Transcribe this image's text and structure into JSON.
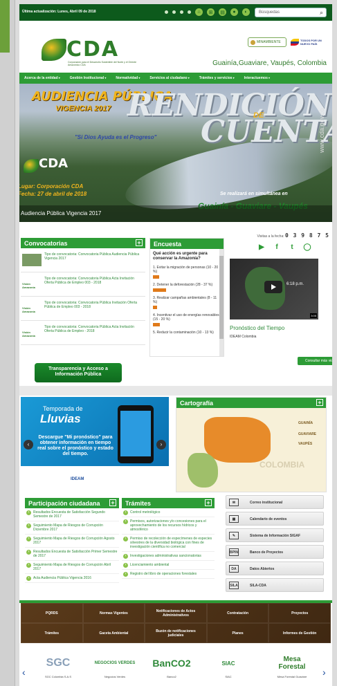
{
  "topbar": {
    "date": "Última actualización: Lunes, Abril 09 de 2018",
    "search_placeholder": "Búsquedas",
    "search_icon": "magnifier-icon"
  },
  "header": {
    "logo_text": "CDA",
    "logo_sub": "Corporación para el Desarrollo Sostenible del Norte y el Oriente Amazónico CDA",
    "minambiente": "MINAMBIENTE",
    "gov_logo": "TODOS POR UN NUEVO PAÍS",
    "region": "Guainía,Guaviare, Vaupés, Colombia"
  },
  "nav": [
    "Acerca de la entidad",
    "Gestión Institucional",
    "Normatividad",
    "Servicios al ciudadano",
    "Trámites y servicios",
    "Interactuemos"
  ],
  "banner": {
    "line1": "AUDIENCIA PÚBLICA",
    "line2": "VIGENCIA 2017",
    "big1": "RENDICIÓN",
    "de": "DE",
    "big2": "CUENTAS",
    "slogan": "\"Si Dios Ayuda es el Progreso\"",
    "logo_text": "CDA",
    "lugar": "Lugar: Corporación CDA",
    "fecha": "Fecha: 27 de abril de 2018",
    "simul": "Se realizará en simultánea en",
    "deps": "Guainía - Guaviare - Vaupés",
    "web": "www.cda.gov.co",
    "caption": "Audiencia Pública Vigencia 2017"
  },
  "convocatorias": {
    "title": "Convocatorias",
    "items": [
      "Tipo de convocatoria: Convocatoria Pública Audiencia Pública Vigencia 2017",
      "Tipo de convocatoria: Convocatoria Pública Acta Invitación Oferta Pública de Empleo 003 - 2018",
      "Tipo de convocatoria: Convocatoria Pública Invitación Oferta Pública de Empleo 003 - 2018",
      "Tipo de convocatoria: Convocatoria Pública Acta Invitación Oferta Pública de Empleo - 2018"
    ],
    "thumb_label": "Visión Amazonía",
    "transparencia": "Transparencia y Acceso a Información Pública"
  },
  "encuesta": {
    "title": "Encuesta",
    "question": "Qué acción es urgente para conservar la Amazonía?",
    "options": [
      {
        "text": "1. Evitar la migración de personas (10 - 20 %)",
        "pct": 15
      },
      {
        "text": "2. Detener la deforestación (28 - 37 %)",
        "pct": 32
      },
      {
        "text": "3. Realizar campañas ambientales (8 - 11 %)",
        "pct": 10
      },
      {
        "text": "4. Incentivar el uso de energías renovables (15 - 20 %)",
        "pct": 17
      },
      {
        "text": "5. Reducir la contaminación (10 - 13 %)",
        "pct": 12
      }
    ]
  },
  "right": {
    "visits_label": "Visitas a la fecha:",
    "visits": "0 3 9 8 7 5",
    "social": [
      "youtube-icon",
      "facebook-icon",
      "twitter-icon",
      "whatsapp-icon"
    ],
    "video_time": "6:18 p.m.",
    "video_dur": "3:05",
    "pronostico": "Pronóstico del Tiempo",
    "ideam": "IDEAM Colombia",
    "more_videos": "Consultar más videos"
  },
  "lluvias": {
    "t1": "Temporada de",
    "t2": "Lluvias",
    "t3": "Descargue \"Mi pronóstico\" para obtener información en tiempo real sobre el pronóstico y estado del tiempo.",
    "foot": "IDEAM"
  },
  "cartografia": {
    "title": "Cartografía",
    "labels": [
      "GUAINÍA",
      "GUAVIARE",
      "VAUPÉS"
    ],
    "country": "COLOMBIA"
  },
  "participacion": {
    "title": "Participación ciudadana",
    "items": [
      "Resultados Encuesta de Satisfacción Segundo Semestre de 2017",
      "Seguimiento Mapa de Riesgos de Corrupción Diciembre 2017",
      "Seguimiento Mapa de Riesgos de Corrupción Agosto 2017",
      "Resultados Encuesta de Satisfacción Primer Semestre de 2017",
      "Seguimiento Mapa de Riesgos de Corrupción Abril 2017",
      "Acta Audiencia Pública Vigencia 2016"
    ]
  },
  "tramites": {
    "title": "Trámites",
    "items": [
      "Control metrológico",
      "Permisos, autorizaciones y/o concesiones para el aprovechamiento de los recursos hídricos y atmosférico",
      "Permiso de recolección de especímenes de especies silvestres de la diversidad biológica con fines de investigación científica no comercial",
      "Investigaciones administrativas sancionatorias",
      "Licenciamiento ambiental",
      "Registro del libro de operaciones forestales"
    ]
  },
  "links": [
    {
      "icon": "mail-icon",
      "glyph": "✉",
      "label": "Correo institucional"
    },
    {
      "icon": "calendar-icon",
      "glyph": "▦",
      "label": "Calendario de eventos"
    },
    {
      "icon": "document-icon",
      "glyph": "✎",
      "label": "Sistema de Información SIGAF"
    },
    {
      "icon": "bpin-icon",
      "glyph": "BPIN",
      "label": "Banco de Proyectos"
    },
    {
      "icon": "open-data-icon",
      "glyph": "DA",
      "label": "Datos Abiertos"
    },
    {
      "icon": "sila-icon",
      "glyph": "SILA",
      "label": "SILA-CDA"
    }
  ],
  "grid": [
    "PQRDS",
    "Normas Vigentes",
    "Notificaciones de Actos Administrativos",
    "Contratación",
    "Proyectos",
    "Trámites",
    "Gaceta Ambiental",
    "Buzón de notificaciones judiciales",
    "Planes",
    "Informes de Gestión"
  ],
  "partners": [
    {
      "logo": "SGC",
      "name": "SGC Colombia S.A.S"
    },
    {
      "logo": "NEGOCIOS VERDES",
      "name": "Negocios Verdes"
    },
    {
      "logo": "BanCO2",
      "name": "Banco2"
    },
    {
      "logo": "SIAC",
      "name": "SIAC"
    },
    {
      "logo": "Mesa Forestal",
      "name": "Mesa Forestal Guaviare"
    }
  ]
}
